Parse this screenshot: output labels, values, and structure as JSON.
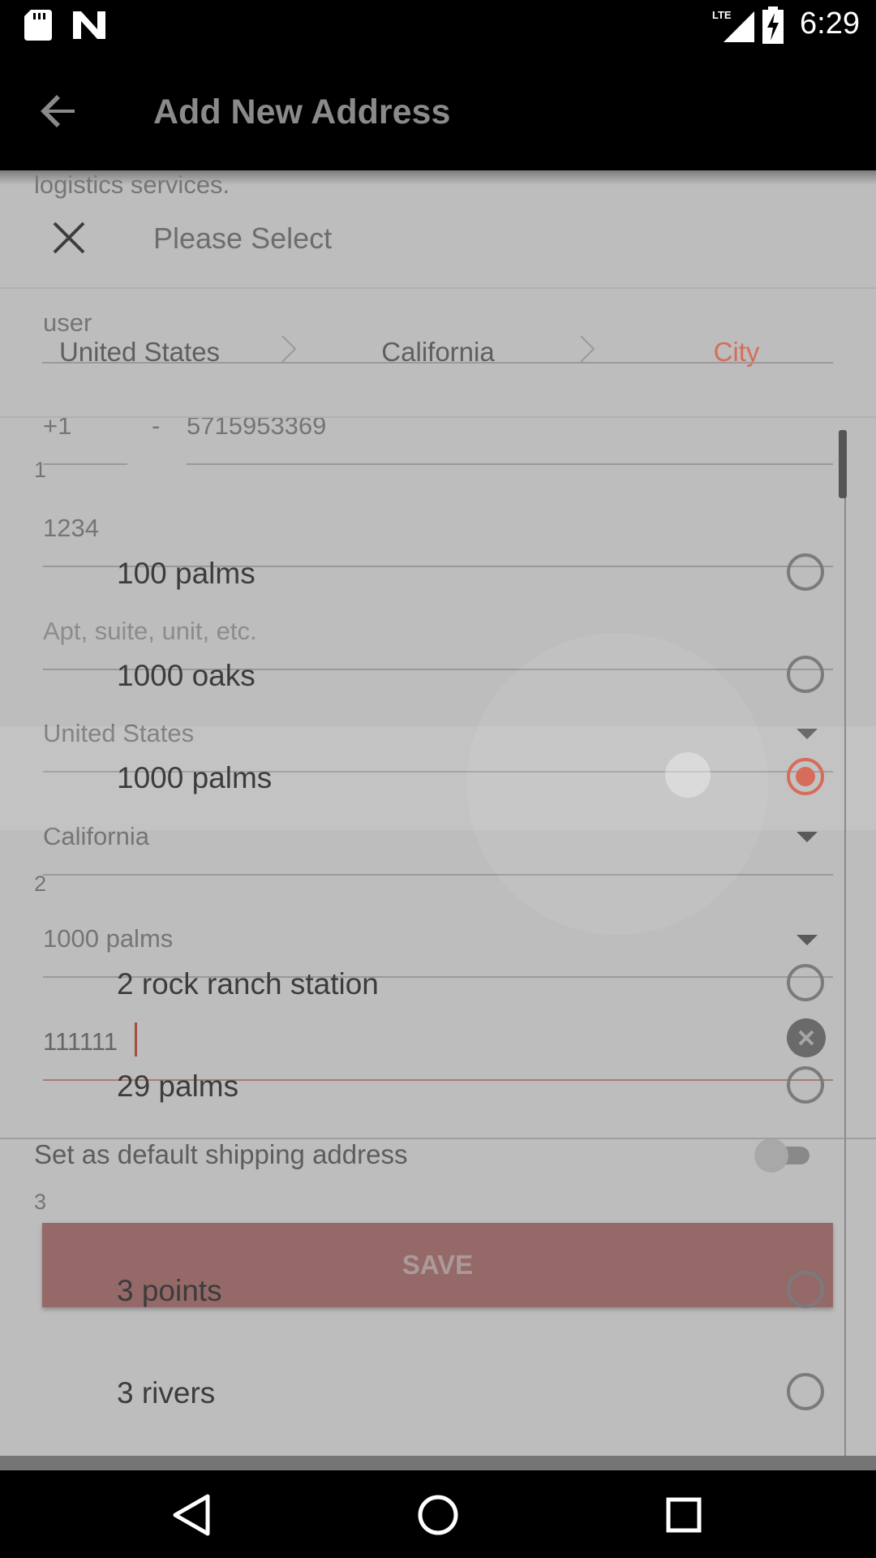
{
  "status_bar": {
    "time": "6:29",
    "icons": [
      "sd-card-icon",
      "n-notification-icon",
      "lte-signal-icon",
      "battery-charging-icon"
    ]
  },
  "toolbar": {
    "title": "Add New Address",
    "back_icon": "arrow-back-icon"
  },
  "background_form": {
    "intro_text": "logistics services.",
    "name_value": "user",
    "phone_code": "+1",
    "phone_separator": "-",
    "phone_number": "5715953369",
    "marker_1": "1",
    "street_value": "1234",
    "apt_placeholder": "Apt, suite, unit, etc.",
    "country_value": "United States",
    "state_value": "California",
    "marker_2": "2",
    "city_value": "1000 palms",
    "zip_value": "111111",
    "default_label": "Set as default shipping address",
    "marker_3": "3",
    "save_label": "SAVE"
  },
  "dialog": {
    "title": "Please Select",
    "close_icon": "close-icon",
    "breadcrumb": [
      "United States",
      "California",
      "City"
    ],
    "active_crumb_color": "#d86c5a"
  },
  "cities": [
    {
      "label": "100 palms",
      "selected": false
    },
    {
      "label": "1000 oaks",
      "selected": false
    },
    {
      "label": "1000 palms",
      "selected": true
    },
    {
      "label": "2 rock ranch station",
      "selected": false
    },
    {
      "label": "29 palms",
      "selected": false
    },
    {
      "label": "3 points",
      "selected": false
    },
    {
      "label": "3 rivers",
      "selected": false
    }
  ],
  "nav_bar": {
    "back": "nav-back-icon",
    "home": "nav-home-icon",
    "recents": "nav-recents-icon"
  },
  "colors": {
    "accent": "#d86c5a",
    "save_button": "#c88e8d"
  }
}
